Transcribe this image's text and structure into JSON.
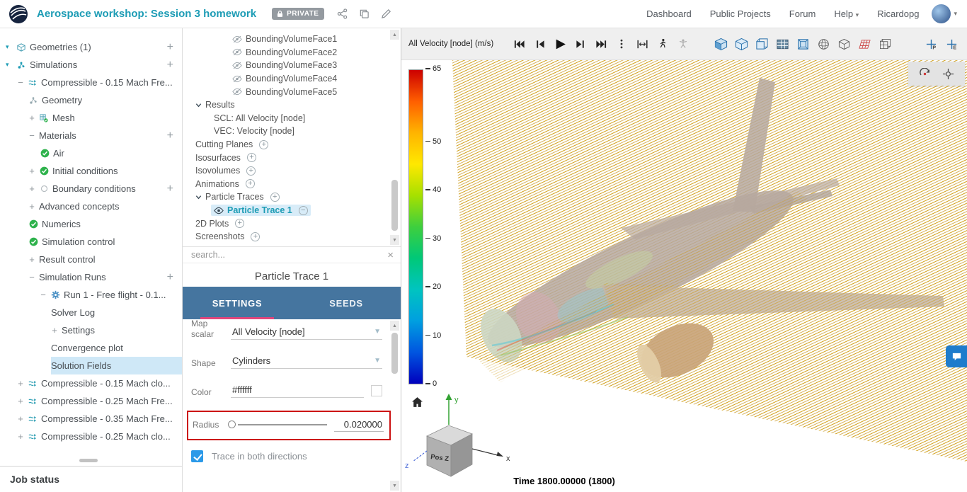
{
  "colors": {
    "accent_teal": "#1d9cb5",
    "tab_bar_blue": "#45759f",
    "tab_underline": "#e0457b",
    "selection_blue": "#cfe8f7",
    "annotation_red": "#cc1111",
    "checkbox_blue": "#2b99e8",
    "streamline_gold": "#d2a017"
  },
  "header": {
    "title": "Aerospace workshop: Session 3 homework",
    "private_badge": "PRIVATE",
    "nav_items": [
      "Dashboard",
      "Public Projects",
      "Forum",
      "Help",
      "Ricardopg"
    ]
  },
  "sidebar": {
    "items": [
      {
        "label": "Geometries (1)",
        "depth": 0,
        "icon": "geom",
        "chev": true,
        "plus": true
      },
      {
        "label": "Simulations",
        "depth": 0,
        "icon": "sim",
        "chev": true,
        "plus": true
      },
      {
        "label": "Compressible - 0.15 Mach Fre...",
        "depth": 1,
        "exp": "minus",
        "icon": "flow"
      },
      {
        "label": "Geometry",
        "depth": 2,
        "icon": "molecule"
      },
      {
        "label": "Mesh",
        "depth": 2,
        "exp": "plus",
        "icon": "mesh"
      },
      {
        "label": "Materials",
        "depth": 2,
        "exp": "minus",
        "plus": true
      },
      {
        "label": "Air",
        "depth": 3,
        "icon": "check"
      },
      {
        "label": "Initial conditions",
        "depth": 2,
        "exp": "plus",
        "icon": "check"
      },
      {
        "label": "Boundary conditions",
        "depth": 2,
        "exp": "plus",
        "icon": "dot",
        "plus": true
      },
      {
        "label": "Advanced concepts",
        "depth": 2,
        "exp": "plus"
      },
      {
        "label": "Numerics",
        "depth": 2,
        "icon": "check"
      },
      {
        "label": "Simulation control",
        "depth": 2,
        "icon": "check"
      },
      {
        "label": "Result control",
        "depth": 2,
        "exp": "plus"
      },
      {
        "label": "Simulation Runs",
        "depth": 2,
        "exp": "minus",
        "plus": true
      },
      {
        "label": "Run 1 - Free flight - 0.1...",
        "depth": 3,
        "exp": "minus",
        "icon": "gear"
      },
      {
        "label": "Solver Log",
        "depth": 4
      },
      {
        "label": "Settings",
        "depth": 4,
        "exp": "plus"
      },
      {
        "label": "Convergence plot",
        "depth": 4
      },
      {
        "label": "Solution Fields",
        "depth": 4,
        "selected": true
      },
      {
        "label": "Compressible - 0.15 Mach clo...",
        "depth": 1,
        "exp": "plus",
        "icon": "flow"
      },
      {
        "label": "Compressible - 0.25 Mach Fre...",
        "depth": 1,
        "exp": "plus",
        "icon": "flow"
      },
      {
        "label": "Compressible - 0.35 Mach Fre...",
        "depth": 1,
        "exp": "plus",
        "icon": "flow"
      },
      {
        "label": "Compressible - 0.25 Mach clo...",
        "depth": 1,
        "exp": "plus",
        "icon": "flow"
      }
    ],
    "job_status_label": "Job status"
  },
  "post_tree": {
    "items": [
      {
        "label": "BoundingVolumeFace1",
        "depth": 2,
        "icon": "eye-off"
      },
      {
        "label": "BoundingVolumeFace2",
        "depth": 2,
        "icon": "eye-off"
      },
      {
        "label": "BoundingVolumeFace3",
        "depth": 2,
        "icon": "eye-off"
      },
      {
        "label": "BoundingVolumeFace4",
        "depth": 2,
        "icon": "eye-off"
      },
      {
        "label": "BoundingVolumeFace5",
        "depth": 2,
        "icon": "eye-off"
      },
      {
        "label": "Results",
        "depth": 0,
        "chev": true
      },
      {
        "label": "SCL: All Velocity [node]",
        "depth": 1
      },
      {
        "label": "VEC: Velocity [node]",
        "depth": 1
      },
      {
        "label": "Cutting Planes",
        "depth": 0,
        "plusc": true
      },
      {
        "label": "Isosurfaces",
        "depth": 0,
        "plusc": true
      },
      {
        "label": "Isovolumes",
        "depth": 0,
        "plusc": true
      },
      {
        "label": "Animations",
        "depth": 0,
        "plusc": true
      },
      {
        "label": "Particle Traces",
        "depth": 0,
        "chev": true,
        "plusc": true
      },
      {
        "label": "Particle Trace 1",
        "depth": 1,
        "icon": "eye",
        "minusc": true,
        "selected": true
      },
      {
        "label": "2D Plots",
        "depth": 0,
        "plusc": true
      },
      {
        "label": "Screenshots",
        "depth": 0,
        "plusc": true
      }
    ],
    "search_placeholder": "search..."
  },
  "particle_panel": {
    "title": "Particle Trace 1",
    "tabs": [
      {
        "label": "SETTINGS",
        "active": true
      },
      {
        "label": "SEEDS",
        "active": false
      }
    ],
    "fields": {
      "map_scalar_label": "Map scalar",
      "map_scalar_value": "All Velocity [node]",
      "shape_label": "Shape",
      "shape_value": "Cylinders",
      "color_label": "Color",
      "color_value": "#ffffff",
      "radius_label": "Radius",
      "radius_value": "0.020000",
      "trace_label": "Trace in both directions",
      "trace_checked": true
    }
  },
  "viewport": {
    "field_label": "All Velocity [node] (m/s)",
    "time_label": "Time 1800.00000 (1800)",
    "nav_cube_label": "Pos Z",
    "axes": {
      "x": "x",
      "y": "y",
      "z": "z"
    },
    "legend": {
      "max": 65,
      "min": 0,
      "ticks": [
        65,
        50,
        40,
        30,
        20,
        10,
        0
      ],
      "gradient": [
        "#cc0000",
        "#ff5f00",
        "#ffb400",
        "#ffe800",
        "#a6e000",
        "#3ecf3e",
        "#00c878",
        "#00c4c0",
        "#009fe0",
        "#0055e0",
        "#0000bd"
      ]
    },
    "toolbar_icons": [
      "skip-start",
      "step-back",
      "play",
      "step-forward",
      "skip-end",
      "kebab-menu",
      "resize-width",
      "walk-person",
      "fly-person",
      "view-cube-shaded",
      "view-cube",
      "view-cube-flat",
      "view-table",
      "view-cube-front",
      "wire-sphere",
      "wire-cube",
      "clip-plane-red",
      "wire-block",
      "axes-p",
      "axes-e"
    ],
    "overlay_icons": [
      "rotate-free",
      "center-target"
    ]
  }
}
